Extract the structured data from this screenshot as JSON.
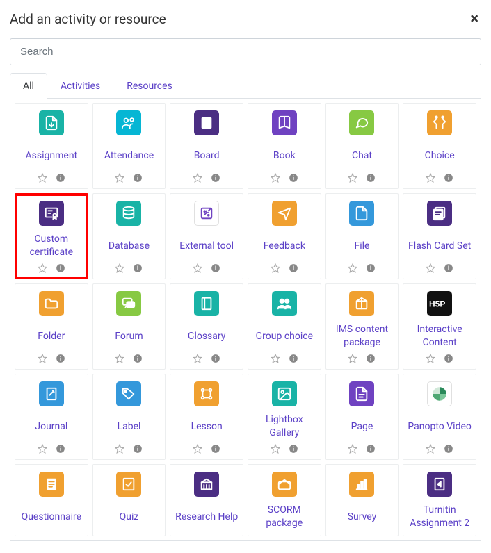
{
  "header": {
    "title": "Add an activity or resource",
    "close": "×"
  },
  "search": {
    "placeholder": "Search"
  },
  "tabs": {
    "all": "All",
    "activities": "Activities",
    "resources": "Resources"
  },
  "items": [
    {
      "label": "Assignment",
      "color": "teal",
      "icon": "assignment"
    },
    {
      "label": "Attendance",
      "color": "cyan",
      "icon": "attendance"
    },
    {
      "label": "Board",
      "color": "darkpurple",
      "icon": "board"
    },
    {
      "label": "Book",
      "color": "purple",
      "icon": "book"
    },
    {
      "label": "Chat",
      "color": "green",
      "icon": "chat"
    },
    {
      "label": "Choice",
      "color": "orange",
      "icon": "choice"
    },
    {
      "label": "Custom certificate",
      "color": "darkpurple",
      "icon": "certificate",
      "highlight": true
    },
    {
      "label": "Database",
      "color": "teal",
      "icon": "database"
    },
    {
      "label": "External tool",
      "color": "white",
      "icon": "external"
    },
    {
      "label": "Feedback",
      "color": "orange",
      "icon": "feedback"
    },
    {
      "label": "File",
      "color": "blue",
      "icon": "file"
    },
    {
      "label": "Flash Card Set",
      "color": "darkpurple",
      "icon": "flashcard"
    },
    {
      "label": "Folder",
      "color": "orange",
      "icon": "folder"
    },
    {
      "label": "Forum",
      "color": "green",
      "icon": "forum"
    },
    {
      "label": "Glossary",
      "color": "teal",
      "icon": "glossary"
    },
    {
      "label": "Group choice",
      "color": "teal",
      "icon": "group"
    },
    {
      "label": "IMS content package",
      "color": "orange",
      "icon": "ims"
    },
    {
      "label": "Interactive Content",
      "color": "black",
      "icon": "h5p"
    },
    {
      "label": "Journal",
      "color": "blue",
      "icon": "journal"
    },
    {
      "label": "Label",
      "color": "blue",
      "icon": "label"
    },
    {
      "label": "Lesson",
      "color": "orange",
      "icon": "lesson"
    },
    {
      "label": "Lightbox Gallery",
      "color": "teal",
      "icon": "lightbox"
    },
    {
      "label": "Page",
      "color": "purple",
      "icon": "page"
    },
    {
      "label": "Panopto Video",
      "color": "white",
      "icon": "panopto"
    },
    {
      "label": "Questionnaire",
      "color": "orange",
      "icon": "questionnaire",
      "truncated": true
    },
    {
      "label": "Quiz",
      "color": "orange",
      "icon": "quiz",
      "truncated": true
    },
    {
      "label": "Research Help",
      "color": "darkpurple",
      "icon": "research",
      "truncated": true
    },
    {
      "label": "SCORM package",
      "color": "orange",
      "icon": "scorm",
      "truncated": true
    },
    {
      "label": "Survey",
      "color": "orange",
      "icon": "survey",
      "truncated": true
    },
    {
      "label": "Turnitin Assignment 2",
      "color": "darkpurple",
      "icon": "turnitin",
      "truncated": true
    }
  ]
}
